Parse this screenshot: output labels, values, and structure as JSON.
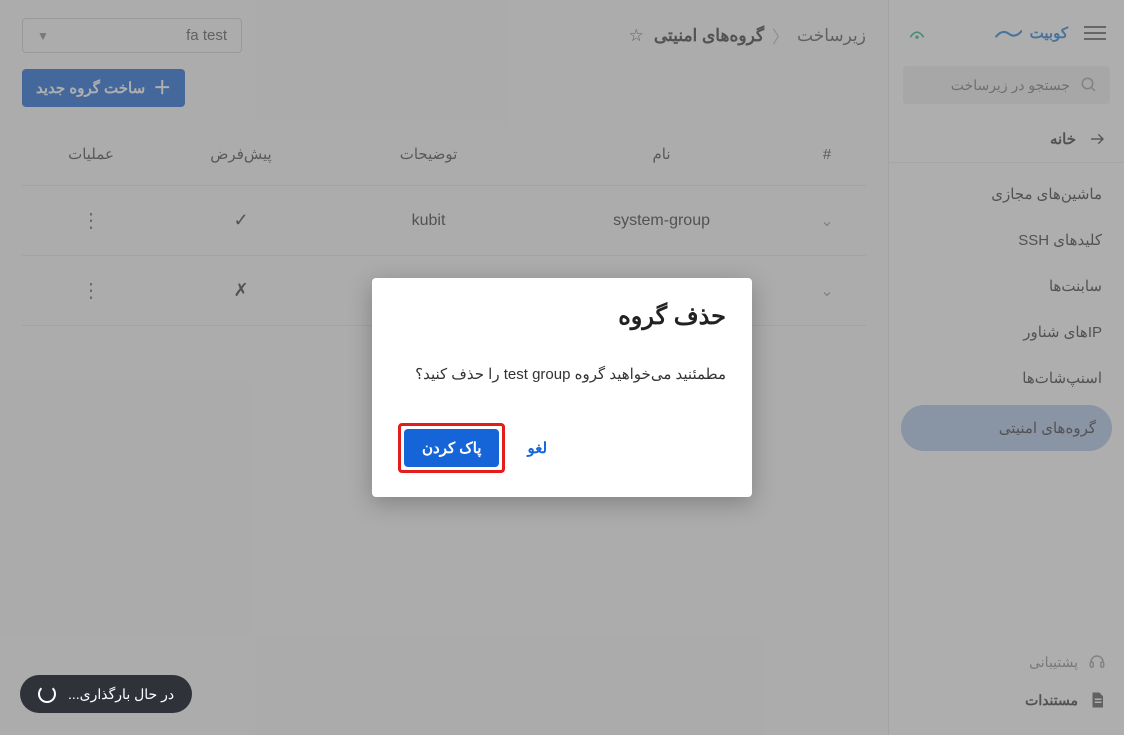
{
  "brand": {
    "name": "کوبیت"
  },
  "sidebar": {
    "search_placeholder": "جستجو در زیرساخت",
    "home": "خانه",
    "items": [
      {
        "label": "ماشین‌های مجازی"
      },
      {
        "label": "کلیدهای SSH"
      },
      {
        "label": "سابنت‌ها"
      },
      {
        "label": "IPهای شناور"
      },
      {
        "label": "اسنپ‌شات‌ها"
      },
      {
        "label": "گروه‌های امنیتی"
      }
    ],
    "footer": {
      "support": "پشتیبانی",
      "docs": "مستندات"
    }
  },
  "breadcrumb": {
    "root": "زیرساخت",
    "leaf": "گروه‌های امنیتی"
  },
  "project_selected": "fa test",
  "create_button": "ساخت گروه جدید",
  "columns": {
    "index": "#",
    "name": "نام",
    "desc": "توضیحات",
    "default": "پیش‌فرض",
    "ops": "عملیات"
  },
  "rows": [
    {
      "name": "system-group",
      "desc": "kubit",
      "default": "✓"
    },
    {
      "name": "",
      "desc": "",
      "default": "✗"
    }
  ],
  "dialog": {
    "title": "حذف گروه",
    "message": "مطمئنید می‌خواهید گروه test group را حذف کنید؟",
    "cancel": "لغو",
    "confirm": "پاک کردن"
  },
  "toast": "در حال بارگذاری..."
}
